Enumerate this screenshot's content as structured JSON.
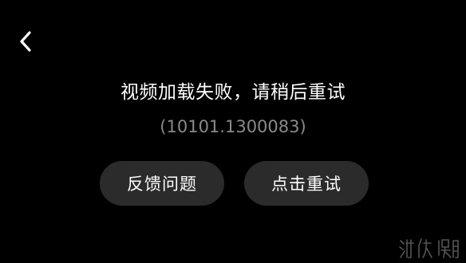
{
  "toolbar": {
    "back_icon": "chevron-left-icon"
  },
  "error": {
    "message": "视频加载失败，请稍后重试",
    "code": "(10101.1300083)"
  },
  "actions": {
    "feedback_label": "反馈问题",
    "retry_label": "点击重试"
  },
  "colors": {
    "background": "#000000",
    "button_bg": "#2b2b2b",
    "code_text": "#8a8a8a",
    "primary_text": "#ffffff"
  },
  "watermark": {
    "text": "游侠网"
  }
}
